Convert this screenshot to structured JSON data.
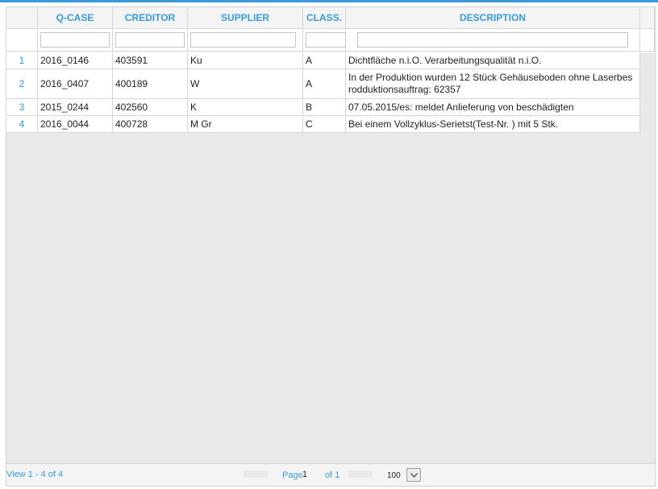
{
  "columns": {
    "qcase": "Q-CASE",
    "creditor": "CREDITOR",
    "supplier": "SUPPLIER",
    "class": "CLASS.",
    "description": "DESCRIPTION"
  },
  "filters": {
    "qcase": "",
    "creditor": "",
    "supplier": "",
    "class": "",
    "description": ""
  },
  "rows": [
    {
      "num": "1",
      "qcase": "2016_0146",
      "creditor": "403591",
      "supplier": "Ku",
      "class": "A",
      "description": "Dichtfläche n.i.O. Verarbeitungsqualität n.i.O."
    },
    {
      "num": "2",
      "qcase": "2016_0407",
      "creditor": "400189",
      "supplier": "W",
      "class": "A",
      "description": "In der Produktion wurden 12 Stück Gehäuseboden ohne Laserbes rodduktionsauftrag: 62357"
    },
    {
      "num": "3",
      "qcase": "2015_0244",
      "creditor": "402560",
      "supplier": "K",
      "class": "B",
      "description": "07.05.2015/es: meldet Anlieferung von beschädigten"
    },
    {
      "num": "4",
      "qcase": "2016_0044",
      "creditor": "400728",
      "supplier": "M Gr",
      "class": "C",
      "description": "Bei einem Vollzyklus-Serietst(Test-Nr. ) mit 5 Stk."
    }
  ],
  "pager": {
    "view_text": "View 1 - 4 of 4",
    "page_label": "Page",
    "page_value": "1",
    "of_text": "of 1",
    "page_size": "100"
  }
}
